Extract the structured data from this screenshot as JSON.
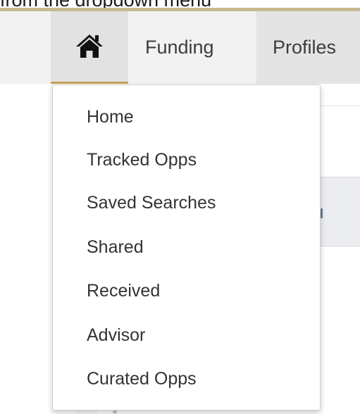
{
  "caption": "from the dropdown menu",
  "nav": {
    "home_icon": "home-icon",
    "items": [
      {
        "label": "Funding"
      },
      {
        "label": "Profiles"
      }
    ]
  },
  "dropdown": {
    "items": [
      {
        "label": "Home"
      },
      {
        "label": "Tracked Opps"
      },
      {
        "label": "Saved Searches"
      },
      {
        "label": "Shared"
      },
      {
        "label": "Received"
      },
      {
        "label": "Advisor"
      },
      {
        "label": "Curated Opps"
      }
    ]
  },
  "colors": {
    "accent_gold": "#c8a15a",
    "nav_background": "#f2f2f2",
    "text": "#333333"
  }
}
